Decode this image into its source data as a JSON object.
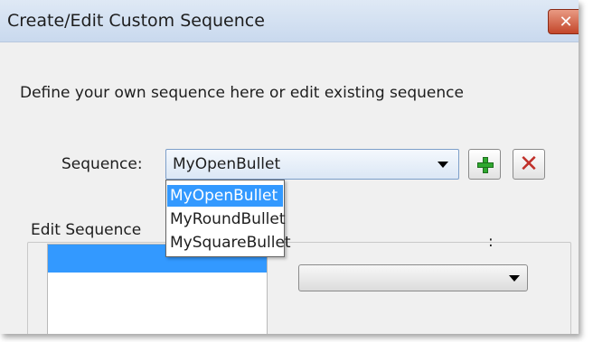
{
  "window": {
    "title": "Create/Edit Custom Sequence",
    "close_glyph": "✕"
  },
  "description": "Define your own sequence here or edit existing sequence",
  "sequence": {
    "label": "Sequence:",
    "selected": "MyOpenBullet",
    "options": [
      "MyOpenBullet",
      "MyRoundBullet",
      "MySquareBullet"
    ],
    "highlighted_index": 0
  },
  "buttons": {
    "add_icon": "green-plus-icon",
    "delete_icon": "red-x-icon",
    "delete_glyph": "✕"
  },
  "edit_group": {
    "label": "Edit Sequence",
    "right_label": ":"
  },
  "colors": {
    "selection": "#3399ff",
    "add": "#2fa82f",
    "delete": "#c0302a",
    "close": "#c3462a"
  }
}
